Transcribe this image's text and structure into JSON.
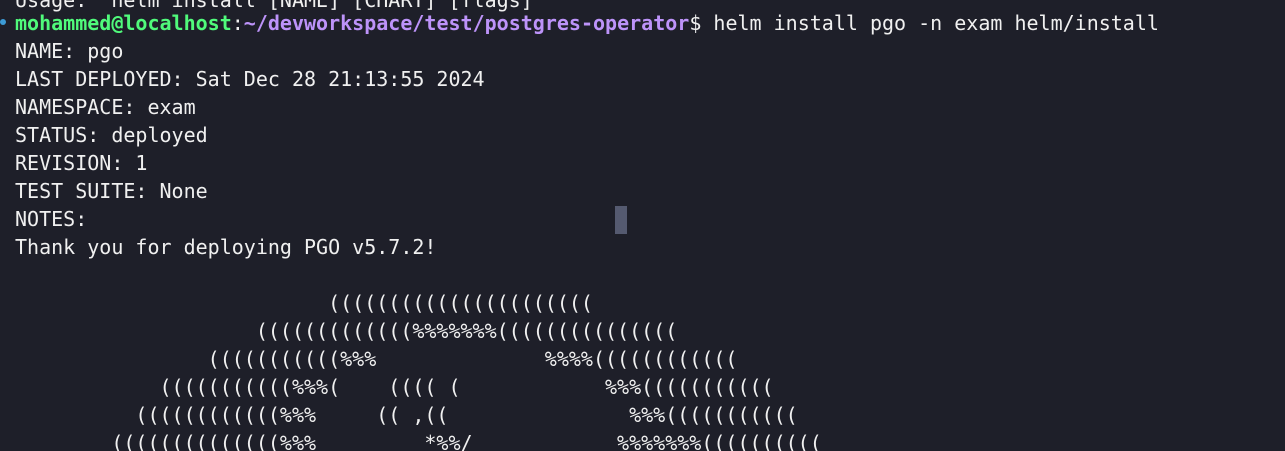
{
  "terminal": {
    "partial_top_line": "Usage:  helm install [NAME] [CHART] [flags]",
    "prompt": {
      "user_host": "mohammed@localhost",
      "separator": ":",
      "cwd": "~/devworkspace/test/postgres-operator",
      "symbol": "$",
      "command": " helm install pgo -n exam helm/install"
    },
    "output": [
      "NAME: pgo",
      "LAST DEPLOYED: Sat Dec 28 21:13:55 2024",
      "NAMESPACE: exam",
      "STATUS: deployed",
      "REVISION: 1",
      "TEST SUITE: None",
      "NOTES:",
      "Thank you for deploying PGO v5.7.2!",
      ""
    ],
    "ascii_art": [
      "                          ((((((((((((((((((((((",
      "                    (((((((((((((%%%%%%%(((((((((((((((",
      "                (((((((((((%%%              %%%%((((((((((((",
      "            (((((((((((%%%(    (((( (            %%%(((((((((((",
      "          ((((((((((((%%%     (( ,((               %%%(((((((((((",
      "        ((((((((((((((%%%         *%%/            %%%%%%%(((((((((("
    ],
    "colors": {
      "background": "#1e1f29",
      "foreground": "#f0f0f0",
      "user_host": "#50fa7b",
      "path": "#bd93f9",
      "prompt_marker": "#3d9bd6",
      "cursor": "#555a70"
    }
  }
}
